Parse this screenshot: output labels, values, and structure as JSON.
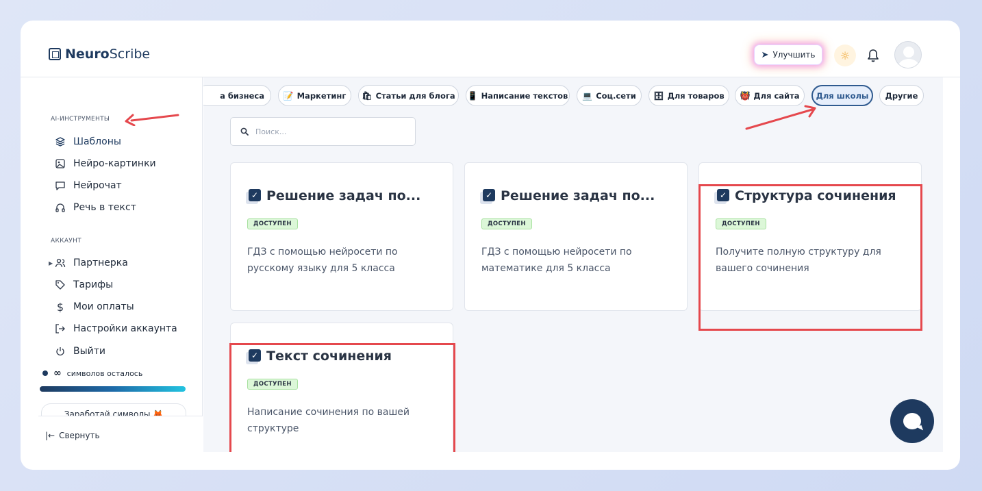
{
  "brand": {
    "name_bold": "Neuro",
    "name_light": "Scribe"
  },
  "header": {
    "upgrade_label": "Улучшить"
  },
  "sidebar": {
    "tools_title": "AI-ИНСТРУМЕНТЫ",
    "tools": [
      {
        "label": "Шаблоны",
        "icon": "layers-icon"
      },
      {
        "label": "Нейро-картинки",
        "icon": "image-icon"
      },
      {
        "label": "Нейрочат",
        "icon": "chat-icon"
      },
      {
        "label": "Речь в текст",
        "icon": "headphones-icon"
      }
    ],
    "account_title": "АККАУНТ",
    "account": [
      {
        "label": "Партнерка",
        "icon": "users-icon"
      },
      {
        "label": "Тарифы",
        "icon": "tag-icon"
      },
      {
        "label": "Мои оплаты",
        "icon": "dollar-icon"
      },
      {
        "label": "Настройки аккаунта",
        "icon": "logout-icon"
      },
      {
        "label": "Выйти",
        "icon": "power-icon"
      }
    ],
    "credits_symbol": "∞",
    "credits_text": "символов осталось",
    "earn_label": "Заработай символы 🦊",
    "collapse_label": "Свернуть"
  },
  "categories": [
    {
      "label": "а бизнеса",
      "emoji": ""
    },
    {
      "label": "Маркетинг",
      "emoji": "📝"
    },
    {
      "label": "Статьи для блога",
      "emoji": "🛍"
    },
    {
      "label": "Написание текстов",
      "emoji": "📱"
    },
    {
      "label": "Соц.сети",
      "emoji": "💻"
    },
    {
      "label": "Для товаров",
      "emoji": "🗄"
    },
    {
      "label": "Для сайта",
      "emoji": "👹"
    },
    {
      "label": "Для школы",
      "emoji": ""
    },
    {
      "label": "Другие",
      "emoji": ""
    }
  ],
  "active_category": "Для школы",
  "search": {
    "placeholder": "Поиск..."
  },
  "cards": [
    {
      "title": "Решение задач по...",
      "badge": "ДОСТУПЕН",
      "desc": "ГДЗ с помощью нейросети по русскому языку для 5 класса"
    },
    {
      "title": "Решение задач по...",
      "badge": "ДОСТУПЕН",
      "desc": "ГДЗ с помощью нейросети по математике для 5 класса"
    },
    {
      "title": "Структура сочинения",
      "badge": "ДОСТУПЕН",
      "desc": "Получите полную структуру для вашего сочинения"
    },
    {
      "title": "Текст сочинения",
      "badge": "ДОСТУПЕН",
      "desc": "Написание сочинения по вашей структуре"
    }
  ],
  "colors": {
    "accent": "#1e3a5f",
    "highlight": "#e5484d",
    "badge_bg": "#dcf7d8"
  }
}
